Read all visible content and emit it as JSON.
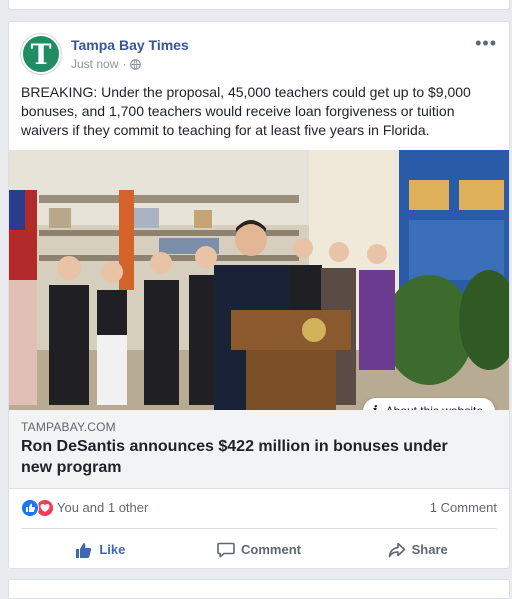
{
  "post": {
    "page_name": "Tampa Bay Times",
    "avatar_letter": "T",
    "timestamp": "Just now",
    "separator": "·",
    "privacy_icon": "globe-icon",
    "more_icon": "more-options-icon",
    "text": "BREAKING: Under the proposal, 45,000 teachers could get up to $9,000 bonuses, and 1,700 teachers would receive loan forgiveness or tuition waivers if they commit to teaching for at least five years in Florida."
  },
  "link": {
    "domain": "TAMPABAY.COM",
    "title": "Ron DeSantis announces $422 million in bonuses under new program",
    "about_label": "About this website",
    "about_icon": "info-icon"
  },
  "reactions": {
    "summary": "You and 1 other",
    "comments": "1 Comment",
    "types": [
      "like",
      "love"
    ]
  },
  "actions": {
    "like": "Like",
    "comment": "Comment",
    "share": "Share"
  },
  "colors": {
    "brand_green": "#1f8c63",
    "link_blue": "#365899",
    "like_blue": "#4267b2"
  }
}
